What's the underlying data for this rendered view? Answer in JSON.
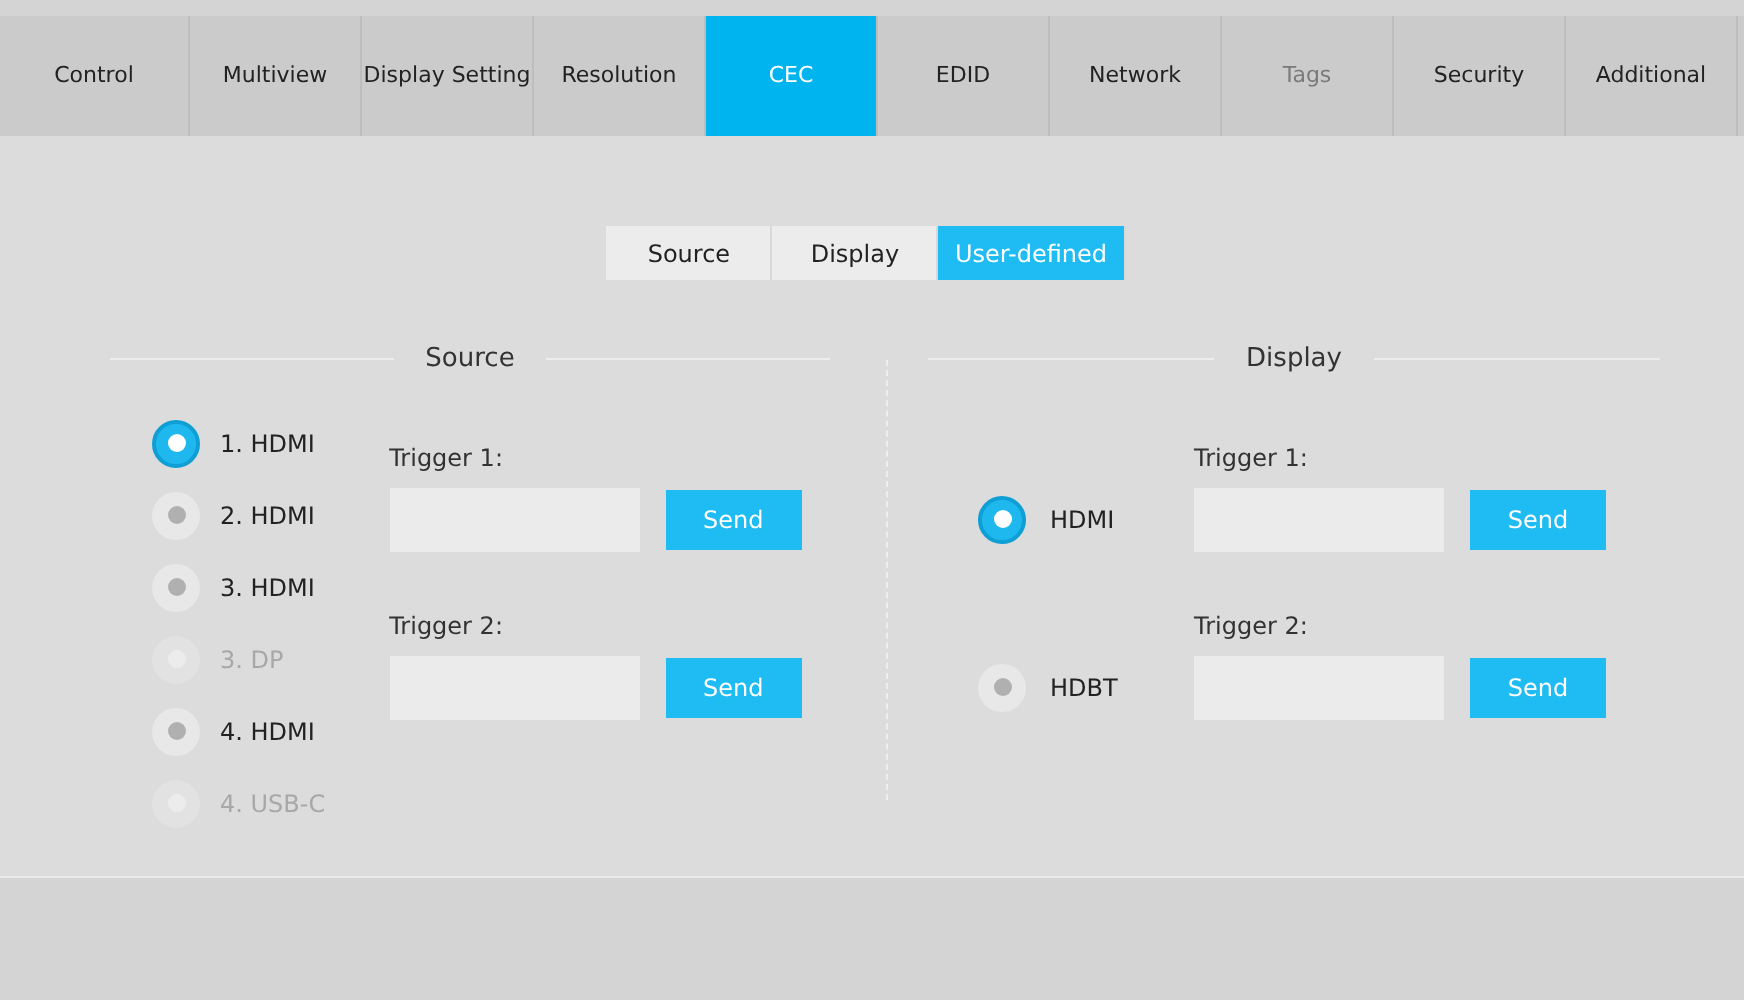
{
  "tabs": [
    {
      "label": "Control",
      "selected": false,
      "disabled": false
    },
    {
      "label": "Multiview",
      "selected": false,
      "disabled": false
    },
    {
      "label": "Display Setting",
      "selected": false,
      "disabled": false
    },
    {
      "label": "Resolution",
      "selected": false,
      "disabled": false
    },
    {
      "label": "CEC",
      "selected": true,
      "disabled": false
    },
    {
      "label": "EDID",
      "selected": false,
      "disabled": false
    },
    {
      "label": "Network",
      "selected": false,
      "disabled": false
    },
    {
      "label": "Tags",
      "selected": false,
      "disabled": true
    },
    {
      "label": "Security",
      "selected": false,
      "disabled": false
    },
    {
      "label": "Additional",
      "selected": false,
      "disabled": false
    }
  ],
  "subtabs": [
    {
      "label": "Source",
      "selected": false
    },
    {
      "label": "Display",
      "selected": false
    },
    {
      "label": "User-defined",
      "selected": true
    }
  ],
  "source": {
    "title": "Source",
    "ports": [
      {
        "label": "1. HDMI",
        "selected": true,
        "disabled": false
      },
      {
        "label": "2. HDMI",
        "selected": false,
        "disabled": false
      },
      {
        "label": "3. HDMI",
        "selected": false,
        "disabled": false
      },
      {
        "label": "3. DP",
        "selected": false,
        "disabled": true
      },
      {
        "label": "4. HDMI",
        "selected": false,
        "disabled": false
      },
      {
        "label": "4. USB-C",
        "selected": false,
        "disabled": true
      }
    ],
    "triggers": [
      {
        "label": "Trigger 1:",
        "button": "Send"
      },
      {
        "label": "Trigger 2:",
        "button": "Send"
      }
    ]
  },
  "display": {
    "title": "Display",
    "rows": [
      {
        "port": "HDMI",
        "selected": true,
        "trigger": "Trigger 1:",
        "button": "Send"
      },
      {
        "port": "HDBT",
        "selected": false,
        "trigger": "Trigger 2:",
        "button": "Send"
      }
    ]
  }
}
